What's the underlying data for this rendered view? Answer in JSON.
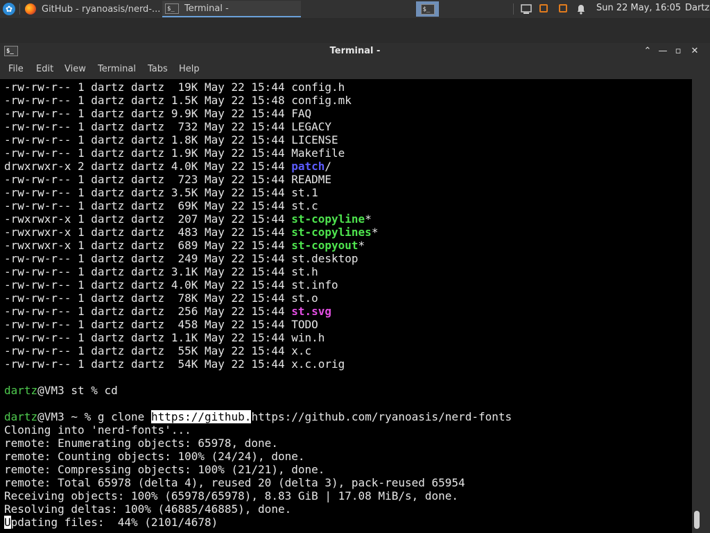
{
  "panel": {
    "task_browser": "GitHub - ryanoasis/nerd-...",
    "task_terminal": "Terminal -",
    "pager_icon": "$_",
    "clock": "Sun 22 May, 16:05",
    "user": "Dartz"
  },
  "window": {
    "title": "Terminal -",
    "icon": "$_",
    "btn_up": "⌃",
    "btn_min": "—",
    "btn_max": "▫",
    "btn_close": "✕"
  },
  "menu": [
    "File",
    "Edit",
    "View",
    "Terminal",
    "Tabs",
    "Help"
  ],
  "colors": {
    "dir": "#5c5cff",
    "exec": "#4ee44e",
    "image": "#e34fe3",
    "user_prompt": "#4ec94e"
  },
  "files": [
    {
      "perms": "-rw-rw-r--",
      "links": "1",
      "owner": "dartz",
      "group": "dartz",
      "size": "19K",
      "date": "May 22 15:44",
      "name": "config.h",
      "type": "plain",
      "suffix": ""
    },
    {
      "perms": "-rw-rw-r--",
      "links": "1",
      "owner": "dartz",
      "group": "dartz",
      "size": "1.5K",
      "date": "May 22 15:48",
      "name": "config.mk",
      "type": "plain",
      "suffix": ""
    },
    {
      "perms": "-rw-rw-r--",
      "links": "1",
      "owner": "dartz",
      "group": "dartz",
      "size": "9.9K",
      "date": "May 22 15:44",
      "name": "FAQ",
      "type": "plain",
      "suffix": ""
    },
    {
      "perms": "-rw-rw-r--",
      "links": "1",
      "owner": "dartz",
      "group": "dartz",
      "size": "732",
      "date": "May 22 15:44",
      "name": "LEGACY",
      "type": "plain",
      "suffix": ""
    },
    {
      "perms": "-rw-rw-r--",
      "links": "1",
      "owner": "dartz",
      "group": "dartz",
      "size": "1.8K",
      "date": "May 22 15:44",
      "name": "LICENSE",
      "type": "plain",
      "suffix": ""
    },
    {
      "perms": "-rw-rw-r--",
      "links": "1",
      "owner": "dartz",
      "group": "dartz",
      "size": "1.9K",
      "date": "May 22 15:44",
      "name": "Makefile",
      "type": "plain",
      "suffix": ""
    },
    {
      "perms": "drwxrwxr-x",
      "links": "2",
      "owner": "dartz",
      "group": "dartz",
      "size": "4.0K",
      "date": "May 22 15:44",
      "name": "patch",
      "type": "dir",
      "suffix": "/"
    },
    {
      "perms": "-rw-rw-r--",
      "links": "1",
      "owner": "dartz",
      "group": "dartz",
      "size": "723",
      "date": "May 22 15:44",
      "name": "README",
      "type": "plain",
      "suffix": ""
    },
    {
      "perms": "-rw-rw-r--",
      "links": "1",
      "owner": "dartz",
      "group": "dartz",
      "size": "3.5K",
      "date": "May 22 15:44",
      "name": "st.1",
      "type": "plain",
      "suffix": ""
    },
    {
      "perms": "-rw-rw-r--",
      "links": "1",
      "owner": "dartz",
      "group": "dartz",
      "size": "69K",
      "date": "May 22 15:44",
      "name": "st.c",
      "type": "plain",
      "suffix": ""
    },
    {
      "perms": "-rwxrwxr-x",
      "links": "1",
      "owner": "dartz",
      "group": "dartz",
      "size": "207",
      "date": "May 22 15:44",
      "name": "st-copyline",
      "type": "exec",
      "suffix": "*"
    },
    {
      "perms": "-rwxrwxr-x",
      "links": "1",
      "owner": "dartz",
      "group": "dartz",
      "size": "483",
      "date": "May 22 15:44",
      "name": "st-copylines",
      "type": "exec",
      "suffix": "*"
    },
    {
      "perms": "-rwxrwxr-x",
      "links": "1",
      "owner": "dartz",
      "group": "dartz",
      "size": "689",
      "date": "May 22 15:44",
      "name": "st-copyout",
      "type": "exec",
      "suffix": "*"
    },
    {
      "perms": "-rw-rw-r--",
      "links": "1",
      "owner": "dartz",
      "group": "dartz",
      "size": "249",
      "date": "May 22 15:44",
      "name": "st.desktop",
      "type": "plain",
      "suffix": ""
    },
    {
      "perms": "-rw-rw-r--",
      "links": "1",
      "owner": "dartz",
      "group": "dartz",
      "size": "3.1K",
      "date": "May 22 15:44",
      "name": "st.h",
      "type": "plain",
      "suffix": ""
    },
    {
      "perms": "-rw-rw-r--",
      "links": "1",
      "owner": "dartz",
      "group": "dartz",
      "size": "4.0K",
      "date": "May 22 15:44",
      "name": "st.info",
      "type": "plain",
      "suffix": ""
    },
    {
      "perms": "-rw-rw-r--",
      "links": "1",
      "owner": "dartz",
      "group": "dartz",
      "size": "78K",
      "date": "May 22 15:44",
      "name": "st.o",
      "type": "plain",
      "suffix": ""
    },
    {
      "perms": "-rw-rw-r--",
      "links": "1",
      "owner": "dartz",
      "group": "dartz",
      "size": "256",
      "date": "May 22 15:44",
      "name": "st.svg",
      "type": "image",
      "suffix": ""
    },
    {
      "perms": "-rw-rw-r--",
      "links": "1",
      "owner": "dartz",
      "group": "dartz",
      "size": "458",
      "date": "May 22 15:44",
      "name": "TODO",
      "type": "plain",
      "suffix": ""
    },
    {
      "perms": "-rw-rw-r--",
      "links": "1",
      "owner": "dartz",
      "group": "dartz",
      "size": "1.1K",
      "date": "May 22 15:44",
      "name": "win.h",
      "type": "plain",
      "suffix": ""
    },
    {
      "perms": "-rw-rw-r--",
      "links": "1",
      "owner": "dartz",
      "group": "dartz",
      "size": "55K",
      "date": "May 22 15:44",
      "name": "x.c",
      "type": "plain",
      "suffix": ""
    },
    {
      "perms": "-rw-rw-r--",
      "links": "1",
      "owner": "dartz",
      "group": "dartz",
      "size": "54K",
      "date": "May 22 15:44",
      "name": "x.c.orig",
      "type": "plain",
      "suffix": ""
    }
  ],
  "prompt1": {
    "user": "dartz",
    "rest": "@VM3 st % cd"
  },
  "prompt2": {
    "user": "dartz",
    "mid": "@VM3 ~ % g clone ",
    "selected": "https://github.",
    "tail": "https://github.com/ryanoasis/nerd-fonts"
  },
  "output": [
    "Cloning into 'nerd-fonts'...",
    "remote: Enumerating objects: 65978, done.",
    "remote: Counting objects: 100% (24/24), done.",
    "remote: Compressing objects: 100% (21/21), done.",
    "remote: Total 65978 (delta 4), reused 20 (delta 3), pack-reused 65954",
    "Receiving objects: 100% (65978/65978), 8.83 GiB | 17.08 MiB/s, done.",
    "Resolving deltas: 100% (46885/46885), done."
  ],
  "last_line": {
    "cursor_char": "U",
    "rest": "pdating files:  44% (2101/4678)"
  }
}
